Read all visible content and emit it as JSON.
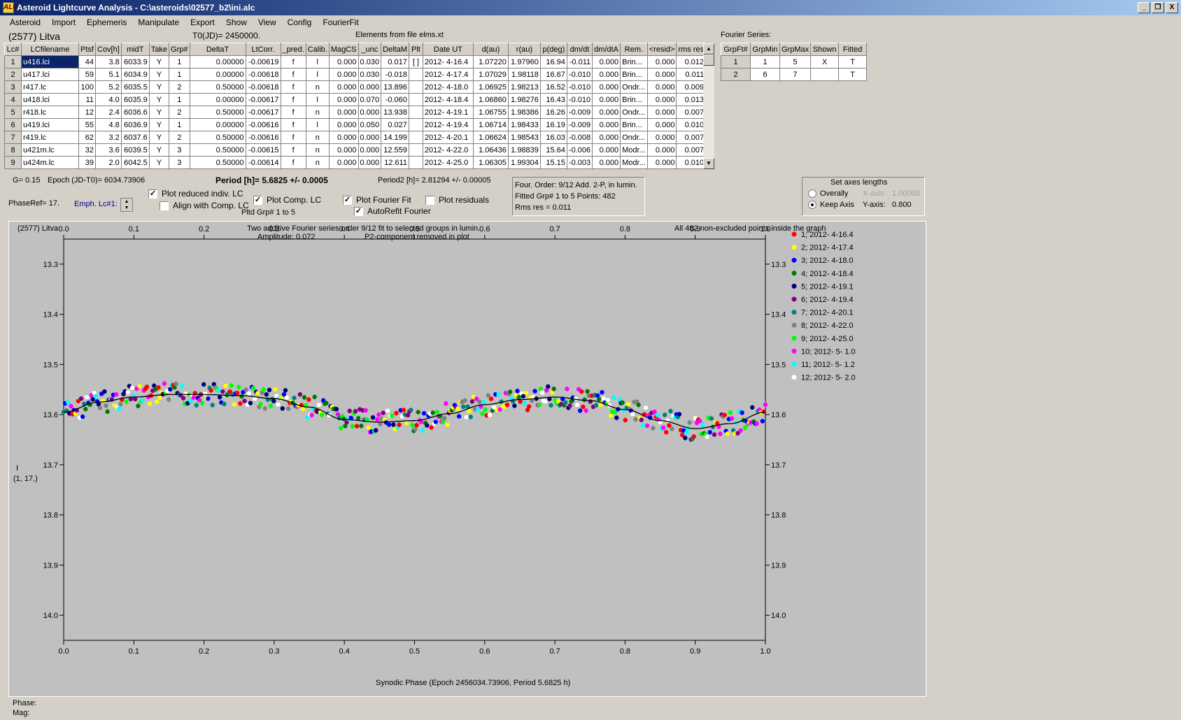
{
  "window": {
    "title": "Asteroid Lightcurve Analysis - C:\\asteroids\\02577_b2\\ini.alc",
    "icon": "ALC",
    "min_label": "_",
    "max_label": "❐",
    "close_label": "X"
  },
  "menu": [
    "Asteroid",
    "Import",
    "Ephemeris",
    "Manipulate",
    "Export",
    "Show",
    "View",
    "Config",
    "FourierFit"
  ],
  "header": {
    "asteroid": "(2577) Litva",
    "t0": "T0(JD)= 2450000.",
    "elements": "Elements from file elms.xt"
  },
  "lc_table": {
    "columns": [
      "Lc#",
      "LCfilename",
      "Ptsf",
      "Cov[h]",
      "midT",
      "Take",
      "Grp#",
      "DeltaT",
      "LtCorr.",
      "_pred.",
      "Calib.",
      "MagCS",
      "_unc",
      "DeltaM",
      "Plt",
      "Date UT",
      "d(au)",
      "r(au)",
      "p(deg)",
      "dm/dt",
      "dm/dtA",
      "Rem.",
      "<resid>",
      "rms res"
    ],
    "rows": [
      [
        "1",
        "u416.lci",
        "44",
        "3.8",
        "6033.9",
        "Y",
        "1",
        "0.00000",
        "-0.00619",
        "f",
        "l",
        "0.000",
        "0.030",
        "0.017",
        "[ ]",
        "2012- 4-16.4",
        "1.07220",
        "1.97960",
        "16.94",
        "-0.011",
        "0.000",
        "Brin...",
        "0.000",
        "0.012"
      ],
      [
        "2",
        "u417.lci",
        "59",
        "5.1",
        "6034.9",
        "Y",
        "1",
        "0.00000",
        "-0.00618",
        "f",
        "l",
        "0.000",
        "0.030",
        "-0.018",
        "",
        "2012- 4-17.4",
        "1.07029",
        "1.98118",
        "16.67",
        "-0.010",
        "0.000",
        "Brin...",
        "0.000",
        "0.011"
      ],
      [
        "3",
        "r417.lc",
        "100",
        "5.2",
        "6035.5",
        "Y",
        "2",
        "0.50000",
        "-0.00618",
        "f",
        "n",
        "0.000",
        "0.000",
        "13.896",
        "",
        "2012- 4-18.0",
        "1.06925",
        "1.98213",
        "16.52",
        "-0.010",
        "0.000",
        "Ondr...",
        "0.000",
        "0.009"
      ],
      [
        "4",
        "u418.lci",
        "11",
        "4.0",
        "6035.9",
        "Y",
        "1",
        "0.00000",
        "-0.00617",
        "f",
        "l",
        "0.000",
        "0.070",
        "-0.060",
        "",
        "2012- 4-18.4",
        "1.06860",
        "1.98276",
        "16.43",
        "-0.010",
        "0.000",
        "Brin...",
        "0.000",
        "0.013"
      ],
      [
        "5",
        "r418.lc",
        "12",
        "2.4",
        "6036.6",
        "Y",
        "2",
        "0.50000",
        "-0.00617",
        "f",
        "n",
        "0.000",
        "0.000",
        "13.938",
        "",
        "2012- 4-19.1",
        "1.06755",
        "1.98386",
        "16.26",
        "-0.009",
        "0.000",
        "Ondr...",
        "0.000",
        "0.007"
      ],
      [
        "6",
        "u419.lci",
        "55",
        "4.8",
        "6036.9",
        "Y",
        "1",
        "0.00000",
        "-0.00616",
        "f",
        "l",
        "0.000",
        "0.050",
        "0.027",
        "",
        "2012- 4-19.4",
        "1.06714",
        "1.98433",
        "16.19",
        "-0.009",
        "0.000",
        "Brin...",
        "0.000",
        "0.010"
      ],
      [
        "7",
        "r419.lc",
        "62",
        "3.2",
        "6037.6",
        "Y",
        "2",
        "0.50000",
        "-0.00616",
        "f",
        "n",
        "0.000",
        "0.000",
        "14.199",
        "",
        "2012- 4-20.1",
        "1.06624",
        "1.98543",
        "16.03",
        "-0.008",
        "0.000",
        "Ondr...",
        "0.000",
        "0.007"
      ],
      [
        "8",
        "u421m.lc",
        "32",
        "3.6",
        "6039.5",
        "Y",
        "3",
        "0.50000",
        "-0.00615",
        "f",
        "n",
        "0.000",
        "0.000",
        "12.559",
        "",
        "2012- 4-22.0",
        "1.06436",
        "1.98839",
        "15.64",
        "-0.006",
        "0.000",
        "Modr...",
        "0.000",
        "0.007"
      ],
      [
        "9",
        "u424m.lc",
        "39",
        "2.0",
        "6042.5",
        "Y",
        "3",
        "0.50000",
        "-0.00614",
        "f",
        "n",
        "0.000",
        "0.000",
        "12.611",
        "",
        "2012- 4-25.0",
        "1.06305",
        "1.99304",
        "15.15",
        "-0.003",
        "0.000",
        "Modr...",
        "0.000",
        "0.010"
      ]
    ]
  },
  "fourier_series": {
    "title": "Fourier Series:",
    "columns": [
      "GrpFt#",
      "GrpMin",
      "GrpMax",
      "Shown",
      "Fitted"
    ],
    "rows": [
      [
        "1",
        "1",
        "5",
        "X",
        "T"
      ],
      [
        "2",
        "6",
        "7",
        "",
        "T"
      ]
    ]
  },
  "controls": {
    "g": "G= 0.15",
    "epoch": "Epoch (JD-T0)= 6034.73906",
    "period": "Period [h]= 5.6825 +/- 0.0005",
    "period2": "Period2 [h]= 2.81294 +/- 0.00005",
    "phaseref": "PhaseRef= 17.",
    "emph": "Emph. Lc#1:",
    "plot_reduced": "Plot reduced indiv. LC",
    "align": "Align with Comp. LC",
    "plot_comp": "Plot Comp. LC",
    "pltd_grp": "Pltd Grp#  1   to   5",
    "plot_fourier": "Plot Fourier Fit",
    "autorefit": "AutoRefit Fourier",
    "plot_residuals": "Plot residuals"
  },
  "fit_info": {
    "line1": "Four. Order:  9/12   Add. 2-P, in lumin.",
    "line2": "Fitted Grp# 1 to 5      Points: 482",
    "line3": "Rms res      = 0.011"
  },
  "axes_panel": {
    "title": "Set axes lengths",
    "overally": "Overally",
    "keep_axis": "Keep Axis",
    "xaxis_label": "X-axis:",
    "xaxis_value": "1.00000",
    "yaxis_label": "Y-axis:",
    "yaxis_value": "0.800"
  },
  "plot": {
    "name": "(2577) Litva",
    "subtitle1": "Two additive Fourier series order 9/12 fit to selected groups in lumin.",
    "subtitle2_a": "Amplitude: 0.072",
    "subtitle2_b": "P2-component removed in plot",
    "note": "All 482 non-excluded points inside the graph",
    "ylabel1": "I",
    "ylabel2": "(1, 17.)",
    "xlabel": "Synodic Phase (Epoch 2456034.73906, Period 5.6825 h)"
  },
  "status": {
    "phase": "Phase:",
    "mag": "Mag:"
  },
  "chart_data": {
    "type": "scatter",
    "title": "Two additive Fourier series order 9/12 fit to selected groups in lumin.",
    "xlabel": "Synodic Phase (Epoch 2456034.73906, Period 5.6825 h)",
    "ylabel": "I (1, 17.)",
    "xlim": [
      0.0,
      1.0
    ],
    "ylim": [
      14.05,
      13.25
    ],
    "y_inverted": true,
    "xticks": [
      "0.0",
      "0.1",
      "0.2",
      "0.3",
      "0.4",
      "0.5",
      "0.6",
      "0.7",
      "0.8",
      "0.9",
      "1.0"
    ],
    "yticks": [
      "13.3",
      "13.4",
      "13.5",
      "13.6",
      "13.7",
      "13.8",
      "13.9",
      "14.0"
    ],
    "fit_curve": {
      "x": [
        0.0,
        0.05,
        0.1,
        0.15,
        0.2,
        0.25,
        0.3,
        0.35,
        0.4,
        0.45,
        0.5,
        0.55,
        0.6,
        0.65,
        0.7,
        0.75,
        0.8,
        0.85,
        0.9,
        0.95,
        1.0
      ],
      "y": [
        13.595,
        13.575,
        13.565,
        13.56,
        13.56,
        13.562,
        13.568,
        13.585,
        13.61,
        13.615,
        13.612,
        13.598,
        13.58,
        13.57,
        13.565,
        13.572,
        13.59,
        13.612,
        13.628,
        13.618,
        13.595
      ]
    },
    "legend": [
      {
        "label": "1; 2012- 4-16.4",
        "color": "#ff0000"
      },
      {
        "label": "2; 2012- 4-17.4",
        "color": "#ffff00"
      },
      {
        "label": "3; 2012- 4-18.0",
        "color": "#0000ff"
      },
      {
        "label": "4; 2012- 4-18.4",
        "color": "#007700"
      },
      {
        "label": "5; 2012- 4-19.1",
        "color": "#000080"
      },
      {
        "label": "6; 2012- 4-19.4",
        "color": "#800080"
      },
      {
        "label": "7; 2012- 4-20.1",
        "color": "#008080"
      },
      {
        "label": "8; 2012- 4-22.0",
        "color": "#808080"
      },
      {
        "label": "9; 2012- 4-25.0",
        "color": "#00ff00"
      },
      {
        "label": "10; 2012- 5- 1.0",
        "color": "#ff00ff"
      },
      {
        "label": "11; 2012- 5- 1.2",
        "color": "#00ffff"
      },
      {
        "label": "12; 2012- 5- 2.0",
        "color": "#ffffff"
      }
    ],
    "legend_position": "right"
  }
}
